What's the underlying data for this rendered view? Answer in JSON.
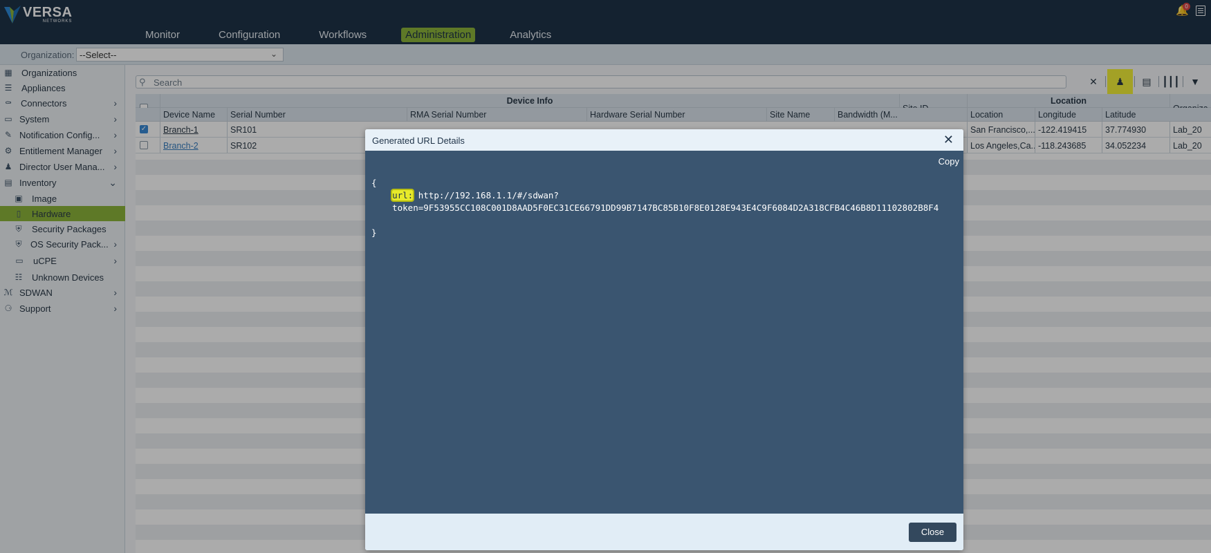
{
  "header": {
    "logo_text": "VERSA",
    "logo_sub": "NETWORKS",
    "nav": [
      "Monitor",
      "Configuration",
      "Workflows",
      "Administration",
      "Analytics"
    ],
    "active_nav": "Administration",
    "notification_count": "0"
  },
  "org": {
    "label": "Organization:",
    "selected": "--Select--"
  },
  "sidebar": {
    "items": [
      {
        "label": "Organizations",
        "icon": "organizations-icon"
      },
      {
        "label": "Appliances",
        "icon": "appliances-icon"
      },
      {
        "label": "Connectors",
        "icon": "connectors-icon"
      },
      {
        "label": "System",
        "icon": "system-icon"
      },
      {
        "label": "Notification Config...",
        "icon": "notification-icon"
      },
      {
        "label": "Entitlement Manager",
        "icon": "entitlement-icon"
      },
      {
        "label": "Director User Mana...",
        "icon": "users-icon"
      },
      {
        "label": "Inventory",
        "icon": "inventory-icon"
      },
      {
        "label": "Image",
        "icon": "image-icon"
      },
      {
        "label": "Hardware",
        "icon": "hardware-icon"
      },
      {
        "label": "Security Packages",
        "icon": "shield-icon"
      },
      {
        "label": "OS Security Pack...",
        "icon": "shield-icon"
      },
      {
        "label": "uCPE",
        "icon": "laptop-icon"
      },
      {
        "label": "Unknown Devices",
        "icon": "unknown-device-icon"
      },
      {
        "label": "SDWAN",
        "icon": "sdwan-icon"
      },
      {
        "label": "Support",
        "icon": "support-icon"
      }
    ]
  },
  "search": {
    "placeholder": "Search"
  },
  "table": {
    "groups": {
      "device_info": "Device Info",
      "site_id": "Site ID",
      "location": "Location",
      "organization": "Organiza"
    },
    "columns": [
      "Device Name",
      "Serial Number",
      "RMA Serial Number",
      "Hardware Serial Number",
      "Site Name",
      "Bandwidth (M...",
      "Location",
      "Longitude",
      "Latitude"
    ],
    "rows": [
      {
        "checked": true,
        "device_name": "Branch-1",
        "serial": "SR101",
        "location": "San Francisco,...",
        "longitude": "-122.419415",
        "latitude": "37.774930",
        "org": "Lab_20"
      },
      {
        "checked": false,
        "device_name": "Branch-2",
        "serial": "SR102",
        "location": "Los Angeles,Ca...",
        "longitude": "-118.243685",
        "latitude": "34.052234",
        "org": "Lab_20"
      }
    ]
  },
  "modal": {
    "title": "Generated URL Details",
    "copy_label": "Copy",
    "open_brace": "{",
    "key": "url:",
    "url_line1": "http://192.168.1.1/#/sdwan?",
    "url_line2": "token=9F53955CC108C001D8AAD5F0EC31CE66791DD99B7147BC85B10F8E0128E943E4C9F6084D2A318CFB4C46B8D11102802B8F4",
    "close_brace": "}",
    "close_label": "Close"
  }
}
